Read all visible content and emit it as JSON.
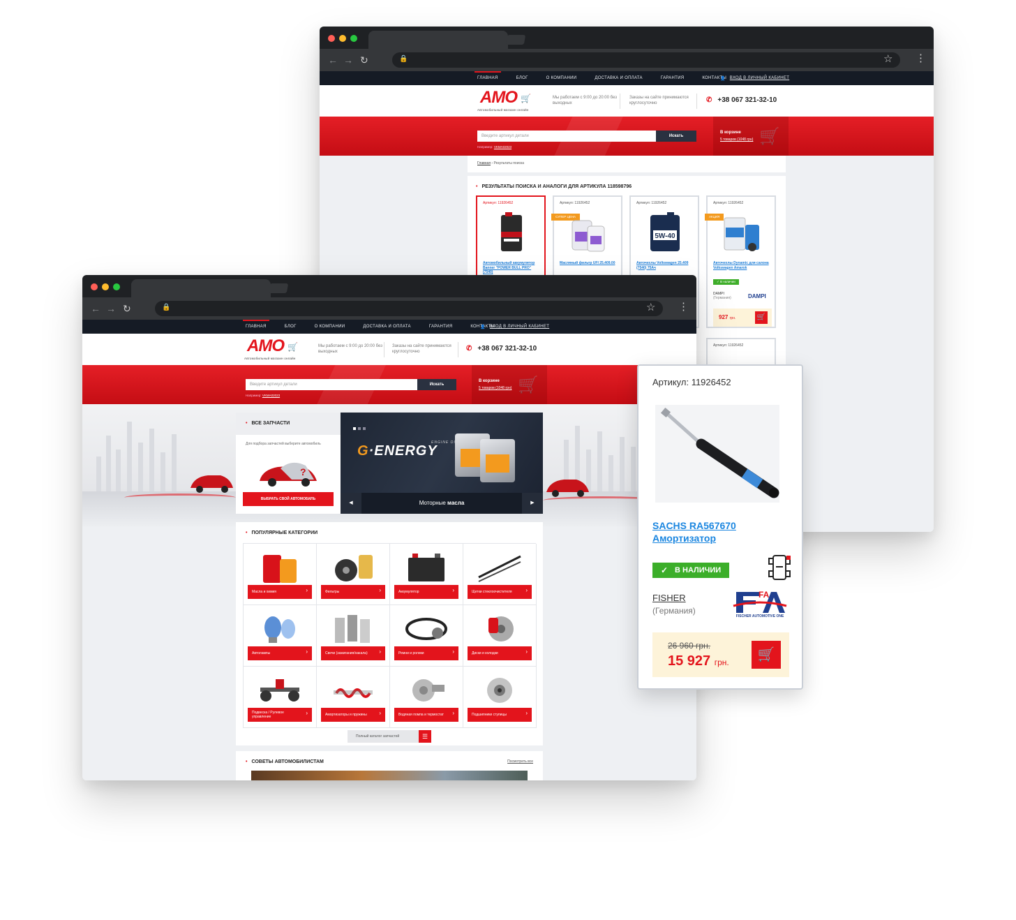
{
  "site": {
    "logo_word": "АМО",
    "logo_tagline": "Автомобильный магазин онлайн",
    "nav": [
      "Главная",
      "Блог",
      "О компании",
      "Доставка и оплата",
      "Гарантия",
      "Контакты"
    ],
    "login": "Вход в личный кабинет",
    "hours": "Мы работаем с 9:00 до 20:00 без выходных",
    "orders": "Заказы на сайте принимаются круглосуточно",
    "phone": "+38 067 321-32-10",
    "search_placeholder": "Введите артикул детали",
    "search_button": "Искать",
    "example_prefix": "Например:",
    "example_value": "VKMA02023",
    "cart_title": "В корзине",
    "cart_summary": "5 товаров (1048 грн)"
  },
  "back": {
    "breadcrumb_home": "Главная",
    "breadcrumb_current": "Результаты поиска",
    "results_title": "Результаты поиска и аналоги для артикула 118598796",
    "products": [
      {
        "article": "Артикул: 11926452",
        "name": "Автомобильный аккумулятор Banner \"POWER BULL PRO\" (7540)",
        "badge": ""
      },
      {
        "article": "Артикул: 11926452",
        "name": "Масляный фильтр UFI 25.409.00",
        "badge": "Супер цена"
      },
      {
        "article": "Артикул: 11926452",
        "name": "Авточехлы Volkswagen 25.409 (7540) 75Ач",
        "badge": ""
      },
      {
        "article": "Артикул: 11926452",
        "name": "Авточехлы Dynamic для салона Volkswagen Amarok",
        "badge": "Акция",
        "availability": "В наличии",
        "brand": "DAMPI",
        "country": "(Германия)",
        "brand_logo": "DAMPI",
        "price": "927",
        "currency": "грн."
      }
    ],
    "second_row_article": "Артикул: 11926452"
  },
  "front": {
    "all_parts_title": "Все запчасти",
    "all_parts_hint": "Для подбора запчастей выберите автомобиль",
    "choose_car_button": "Выбрать свой автомобиль",
    "banner_brand_a": "G",
    "banner_brand_b": "·ENERGY",
    "banner_sub": "ENGINE OIL",
    "banner_caption_a": "Моторные",
    "banner_caption_b": "масла",
    "popular_title": "Популярные категории",
    "categories": [
      "Масла и химия",
      "Фильтры",
      "Аккумулятор",
      "Щетки стеклоочистителя",
      "Автолампы",
      "Свечи (зажигания/накала)",
      "Ремни и ролики",
      "Диски и колодки",
      "Подвеска / Рулевое управление",
      "Амортизаторы и пружины",
      "Водяная помпа и термостат",
      "Подшипники ступицы"
    ],
    "catalog_button": "Полный каталог запчастей",
    "tips_title": "Советы автомобилистам",
    "tips_all": "Посмотреть все"
  },
  "popup": {
    "article": "Артикул: 11926452",
    "name_line1": "SACHS RA567670",
    "name_line2": "Амортизатор",
    "availability": "В НАЛИЧИИ",
    "brand": "FISHER",
    "country": "(Германия)",
    "brand_logo": "FA",
    "brand_logo_caption": "FISCHER AUTOMOTIVE ONE",
    "old_price": "26 960 грн.",
    "new_price": "15 927",
    "currency": "грн."
  },
  "colors": {
    "brand_red": "#e3141c",
    "nav_dark": "#151b25",
    "available_green": "#3bae29",
    "link_blue": "#1b86e0"
  },
  "icons": [
    "lock-icon",
    "star-icon",
    "menu-icon",
    "back-icon",
    "forward-icon",
    "reload-icon",
    "cart-icon",
    "phone-icon",
    "user-icon",
    "check-icon",
    "car-scheme-icon"
  ]
}
